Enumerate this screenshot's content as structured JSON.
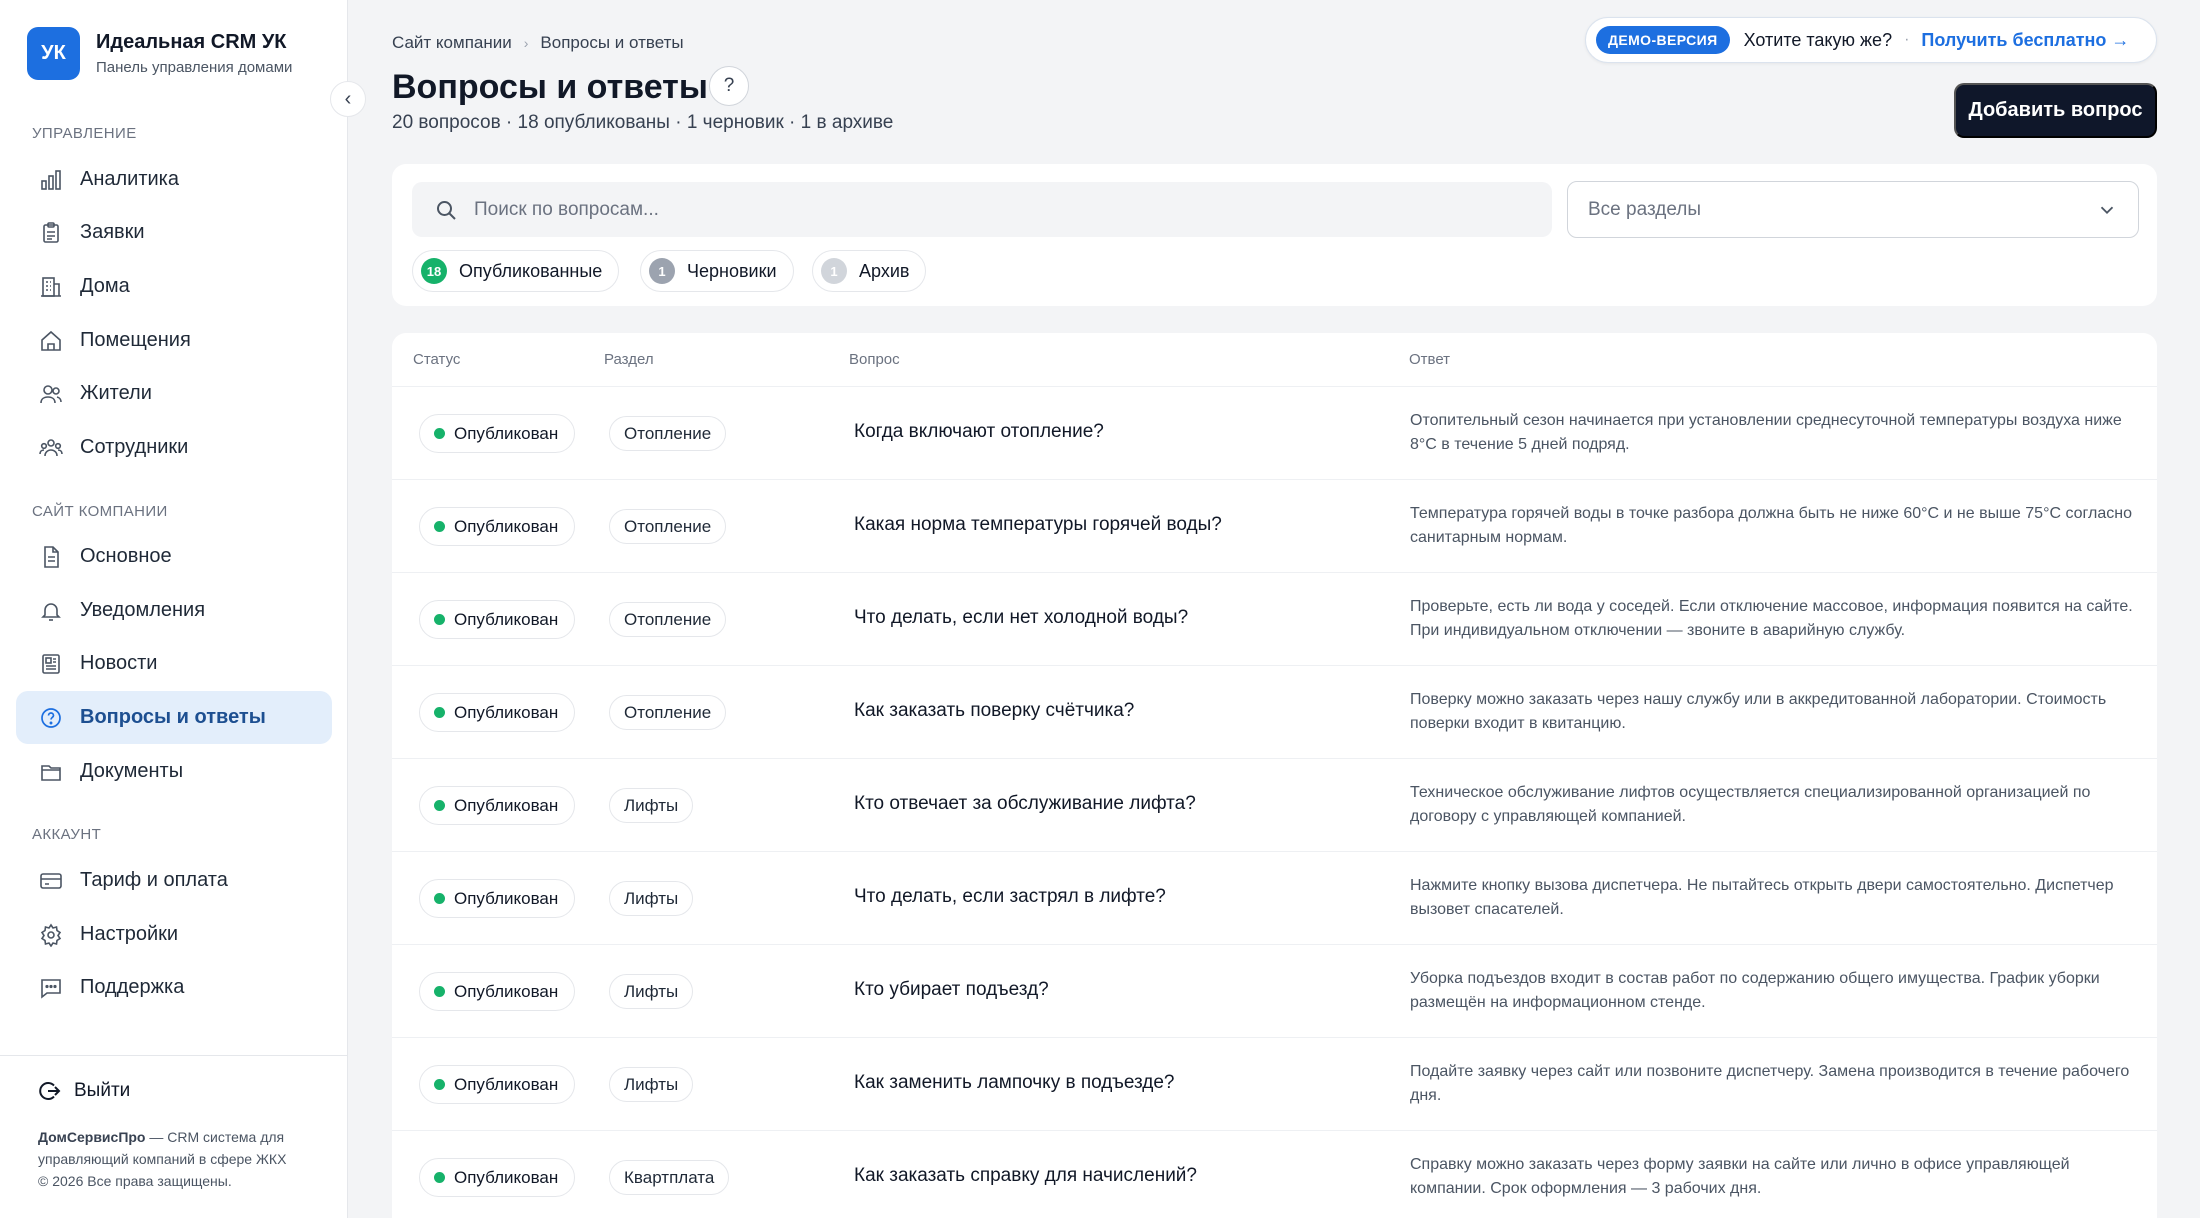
{
  "sidebar": {
    "logo": "УК",
    "brand_name": "Идеальная CRM УК",
    "brand_subtitle": "Панель управления домами",
    "sections": [
      {
        "label": "УПРАВЛЕНИЕ",
        "items": [
          {
            "label": "Аналитика",
            "icon": "chart-icon"
          },
          {
            "label": "Заявки",
            "icon": "clipboard-icon"
          },
          {
            "label": "Дома",
            "icon": "building-icon"
          },
          {
            "label": "Помещения",
            "icon": "home-icon"
          },
          {
            "label": "Жители",
            "icon": "users-icon"
          },
          {
            "label": "Сотрудники",
            "icon": "team-icon"
          }
        ]
      },
      {
        "label": "САЙТ КОМПАНИИ",
        "items": [
          {
            "label": "Основное",
            "icon": "file-icon"
          },
          {
            "label": "Уведомления",
            "icon": "bell-icon"
          },
          {
            "label": "Новости",
            "icon": "newspaper-icon"
          },
          {
            "label": "Вопросы и ответы",
            "icon": "help-circle-icon",
            "active": true
          },
          {
            "label": "Документы",
            "icon": "folder-icon"
          }
        ]
      },
      {
        "label": "АККАУНТ",
        "items": [
          {
            "label": "Тариф и оплата",
            "icon": "credit-card-icon"
          },
          {
            "label": "Настройки",
            "icon": "gear-icon"
          },
          {
            "label": "Поддержка",
            "icon": "chat-icon"
          }
        ]
      }
    ],
    "logout_label": "Выйти",
    "footer_brand": "ДомСервисПро",
    "footer_text": " — CRM система для управляющий компаний в сфере ЖКХ",
    "footer_copy": "© 2026 Все права защищены."
  },
  "header": {
    "breadcrumb": [
      "Сайт компании",
      "Вопросы и ответы"
    ],
    "title": "Вопросы и ответы",
    "help_symbol": "?",
    "summary": "20 вопросов · 18 опубликованы · 1 черновик · 1 в архиве",
    "add_button": "Добавить вопрос"
  },
  "demo": {
    "badge": "ДЕМО-ВЕРСИЯ",
    "text": "Хотите такую же?",
    "separator": "·",
    "link": "Получить бесплатно →"
  },
  "filters": {
    "search_placeholder": "Поиск по вопросам...",
    "section_select": "Все разделы",
    "chips": [
      {
        "count": "18",
        "label": "Опубликованные",
        "color": "#16b26a"
      },
      {
        "count": "1",
        "label": "Черновики",
        "color": "#9ca3af"
      },
      {
        "count": "1",
        "label": "Архив",
        "color": "#d1d5db"
      }
    ]
  },
  "table": {
    "columns": [
      "Статус",
      "Раздел",
      "Вопрос",
      "Ответ"
    ],
    "rows": [
      {
        "status": "Опубликован",
        "category": "Отопление",
        "question": "Когда включают отопление?",
        "answer": "Отопительный сезон начинается при установлении среднесуточной температуры воздуха ниже 8°C в течение 5 дней подряд."
      },
      {
        "status": "Опубликован",
        "category": "Отопление",
        "question": "Какая норма температуры горячей воды?",
        "answer": "Температура горячей воды в точке разбора должна быть не ниже 60°C и не выше 75°C согласно санитарным нормам."
      },
      {
        "status": "Опубликован",
        "category": "Отопление",
        "question": "Что делать, если нет холодной воды?",
        "answer": "Проверьте, есть ли вода у соседей. Если отключение массовое, информация появится на сайте. При индивидуальном отключении — звоните в аварийную службу."
      },
      {
        "status": "Опубликован",
        "category": "Отопление",
        "question": "Как заказать поверку счётчика?",
        "answer": "Поверку можно заказать через нашу службу или в аккредитованной лаборатории. Стоимость поверки входит в квитанцию."
      },
      {
        "status": "Опубликован",
        "category": "Лифты",
        "question": "Кто отвечает за обслуживание лифта?",
        "answer": "Техническое обслуживание лифтов осуществляется специализированной организацией по договору с управляющей компанией."
      },
      {
        "status": "Опубликован",
        "category": "Лифты",
        "question": "Что делать, если застрял в лифте?",
        "answer": "Нажмите кнопку вызова диспетчера. Не пытайтесь открыть двери самостоятельно. Диспетчер вызовет спасателей."
      },
      {
        "status": "Опубликован",
        "category": "Лифты",
        "question": "Кто убирает подъезд?",
        "answer": "Уборка подъездов входит в состав работ по содержанию общего имущества. График уборки размещён на информационном стенде."
      },
      {
        "status": "Опубликован",
        "category": "Лифты",
        "question": "Как заменить лампочку в подъезде?",
        "answer": "Подайте заявку через сайт или позвоните диспетчеру. Замена производится в течение рабочего дня."
      },
      {
        "status": "Опубликован",
        "category": "Квартплата",
        "question": "Как заказать справку для начислений?",
        "answer": "Справку можно заказать через форму заявки на сайте или лично в офисе управляющей компании. Срок оформления — 3 рабочих дня."
      }
    ]
  },
  "colors": {
    "accent": "#1d6fe0",
    "published": "#16b26a",
    "dark_button": "#0f172a"
  }
}
